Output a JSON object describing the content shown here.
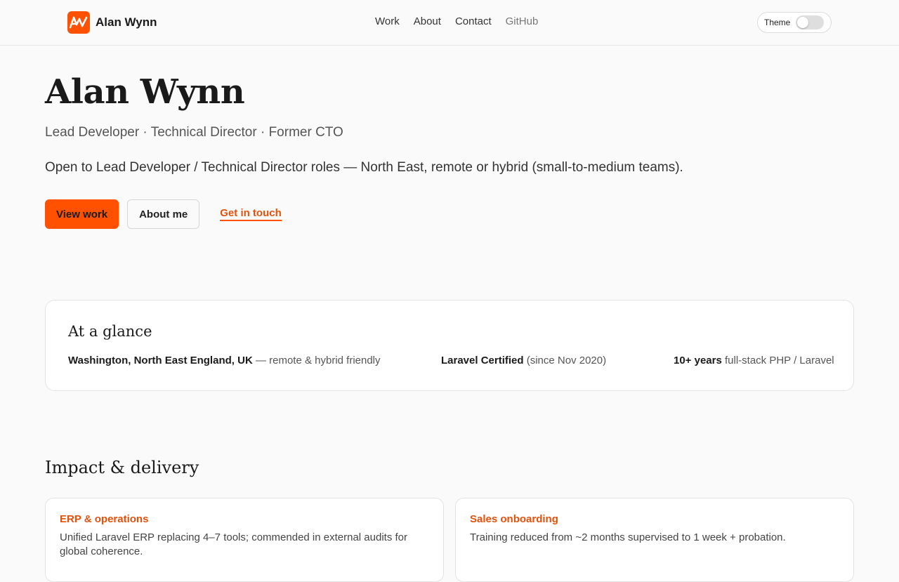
{
  "header": {
    "brand_name": "Alan Wynn",
    "nav": [
      "Work",
      "About",
      "Contact",
      "GitHub"
    ],
    "theme_label": "Theme"
  },
  "hero": {
    "name": "Alan Wynn",
    "tagline": "Lead Developer · Technical Director · Former CTO",
    "availability": "Open to Lead Developer / Technical Director roles — North East, remote or hybrid (small-to-medium teams).",
    "cta_primary": "View work",
    "cta_secondary": "About me",
    "cta_link": "Get in touch"
  },
  "glance": {
    "title": "At a glance",
    "facts": [
      {
        "strong": "Washington, North East England, UK",
        "rest": " — remote & hybrid friendly"
      },
      {
        "strong": "Laravel Certified",
        "rest": " (since Nov 2020)"
      },
      {
        "strong": "10+ years",
        "rest": " full-stack PHP / Laravel"
      }
    ]
  },
  "impact": {
    "title": "Impact & delivery",
    "cards": [
      {
        "label": "ERP & operations",
        "text": "Unified Laravel ERP replacing 4–7 tools; commended in external audits for global coherence."
      },
      {
        "label": "Sales onboarding",
        "text": "Training reduced from ~2 months supervised to 1 week + probation."
      }
    ]
  },
  "colors": {
    "accent": "#ff5100",
    "accent_text": "#e2520d"
  }
}
